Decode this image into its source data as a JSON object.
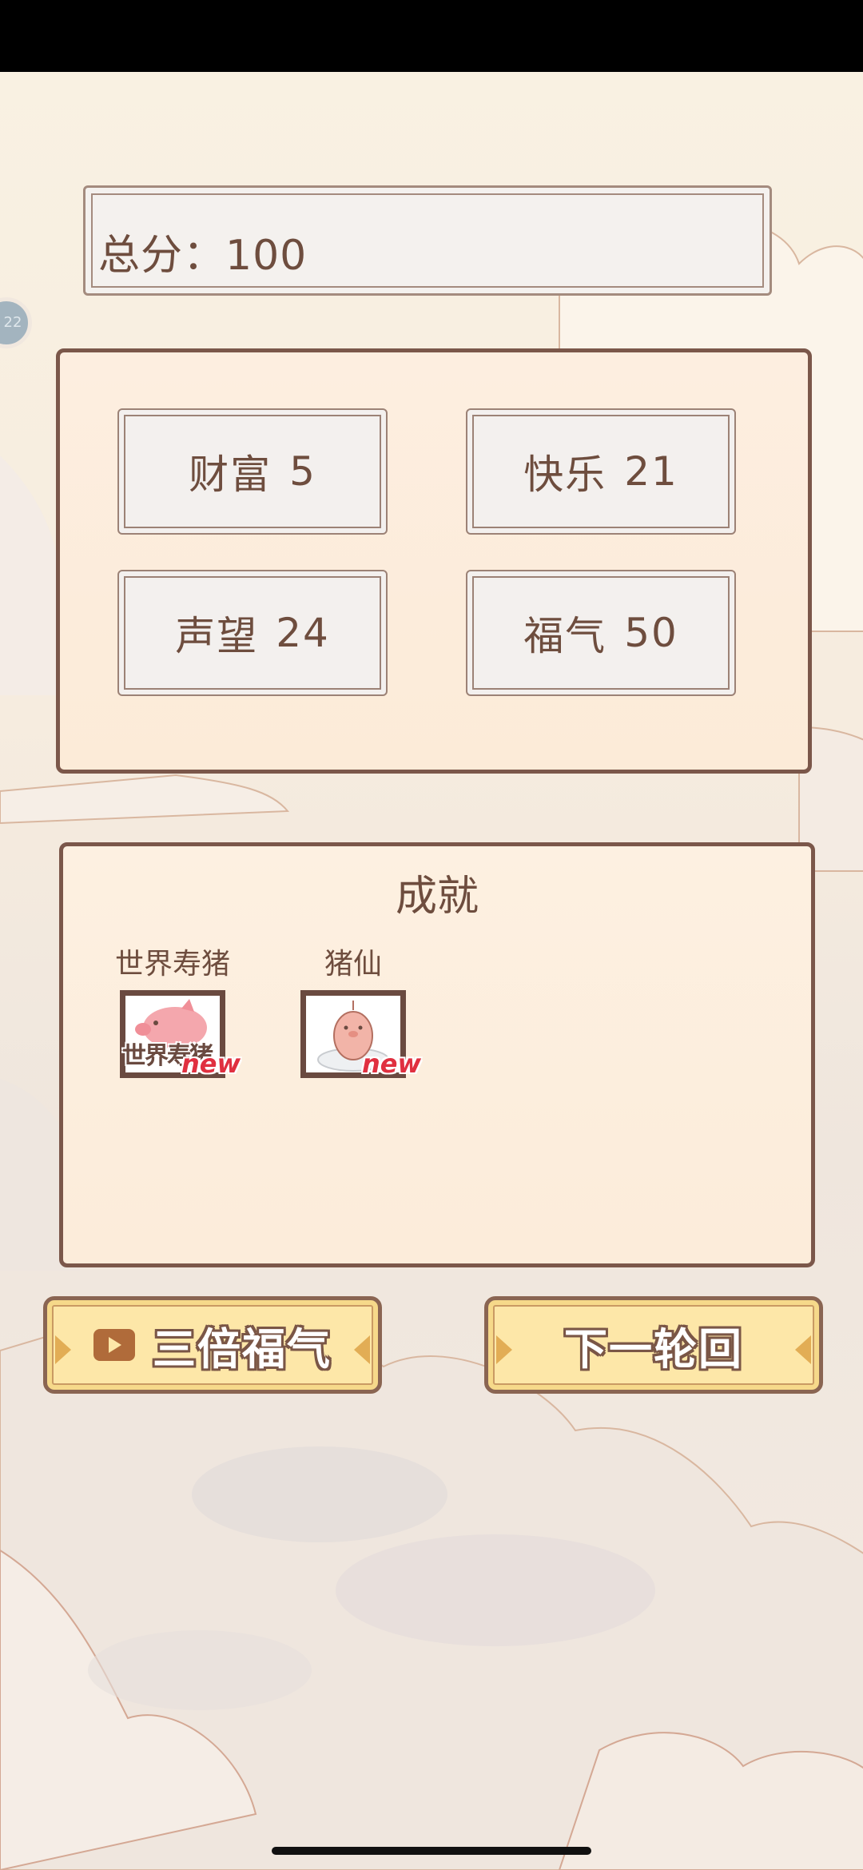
{
  "total": {
    "text": "总分：100"
  },
  "side_bubble": {
    "text": "22"
  },
  "stats": [
    {
      "name": "财富",
      "value": "5"
    },
    {
      "name": "快乐",
      "value": "21"
    },
    {
      "name": "声望",
      "value": "24"
    },
    {
      "name": "福气",
      "value": "50"
    }
  ],
  "achievements": {
    "title": "成就",
    "items": [
      {
        "label": "世界寿猪",
        "badge": "new",
        "icon_text": "世界寿猪",
        "icon": "pink-pig-icon"
      },
      {
        "label": "猪仙",
        "badge": "new",
        "icon": "pig-immortal-on-cloud-icon"
      }
    ]
  },
  "buttons": {
    "triple": "三倍福气",
    "next": "下一轮回"
  },
  "colors": {
    "panel_border": "#7b574a",
    "button_fill": "#fde7a8",
    "new_badge": "#e03040"
  }
}
